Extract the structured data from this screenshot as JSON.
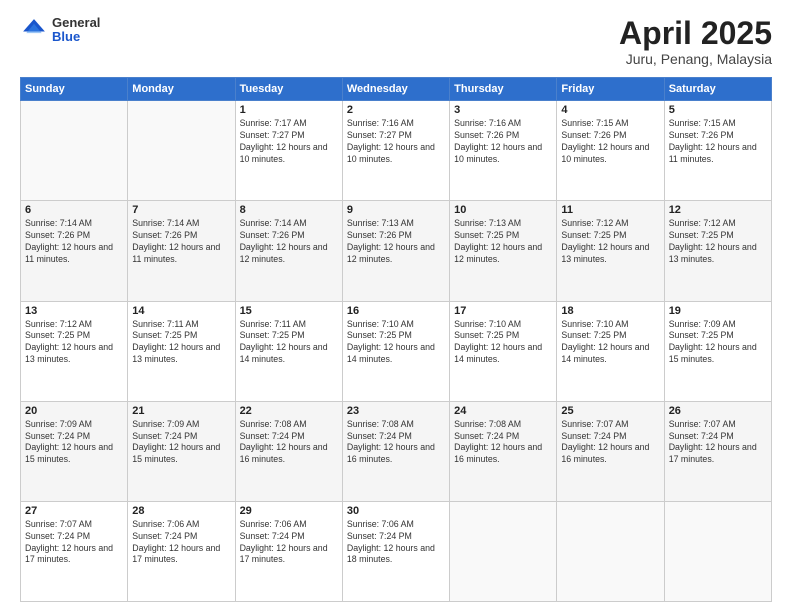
{
  "header": {
    "logo_general": "General",
    "logo_blue": "Blue",
    "title": "April 2025",
    "subtitle": "Juru, Penang, Malaysia"
  },
  "calendar": {
    "days_of_week": [
      "Sunday",
      "Monday",
      "Tuesday",
      "Wednesday",
      "Thursday",
      "Friday",
      "Saturday"
    ],
    "weeks": [
      [
        {
          "day": "",
          "info": ""
        },
        {
          "day": "",
          "info": ""
        },
        {
          "day": "1",
          "info": "Sunrise: 7:17 AM\nSunset: 7:27 PM\nDaylight: 12 hours and 10 minutes."
        },
        {
          "day": "2",
          "info": "Sunrise: 7:16 AM\nSunset: 7:27 PM\nDaylight: 12 hours and 10 minutes."
        },
        {
          "day": "3",
          "info": "Sunrise: 7:16 AM\nSunset: 7:26 PM\nDaylight: 12 hours and 10 minutes."
        },
        {
          "day": "4",
          "info": "Sunrise: 7:15 AM\nSunset: 7:26 PM\nDaylight: 12 hours and 10 minutes."
        },
        {
          "day": "5",
          "info": "Sunrise: 7:15 AM\nSunset: 7:26 PM\nDaylight: 12 hours and 11 minutes."
        }
      ],
      [
        {
          "day": "6",
          "info": "Sunrise: 7:14 AM\nSunset: 7:26 PM\nDaylight: 12 hours and 11 minutes."
        },
        {
          "day": "7",
          "info": "Sunrise: 7:14 AM\nSunset: 7:26 PM\nDaylight: 12 hours and 11 minutes."
        },
        {
          "day": "8",
          "info": "Sunrise: 7:14 AM\nSunset: 7:26 PM\nDaylight: 12 hours and 12 minutes."
        },
        {
          "day": "9",
          "info": "Sunrise: 7:13 AM\nSunset: 7:26 PM\nDaylight: 12 hours and 12 minutes."
        },
        {
          "day": "10",
          "info": "Sunrise: 7:13 AM\nSunset: 7:25 PM\nDaylight: 12 hours and 12 minutes."
        },
        {
          "day": "11",
          "info": "Sunrise: 7:12 AM\nSunset: 7:25 PM\nDaylight: 12 hours and 13 minutes."
        },
        {
          "day": "12",
          "info": "Sunrise: 7:12 AM\nSunset: 7:25 PM\nDaylight: 12 hours and 13 minutes."
        }
      ],
      [
        {
          "day": "13",
          "info": "Sunrise: 7:12 AM\nSunset: 7:25 PM\nDaylight: 12 hours and 13 minutes."
        },
        {
          "day": "14",
          "info": "Sunrise: 7:11 AM\nSunset: 7:25 PM\nDaylight: 12 hours and 13 minutes."
        },
        {
          "day": "15",
          "info": "Sunrise: 7:11 AM\nSunset: 7:25 PM\nDaylight: 12 hours and 14 minutes."
        },
        {
          "day": "16",
          "info": "Sunrise: 7:10 AM\nSunset: 7:25 PM\nDaylight: 12 hours and 14 minutes."
        },
        {
          "day": "17",
          "info": "Sunrise: 7:10 AM\nSunset: 7:25 PM\nDaylight: 12 hours and 14 minutes."
        },
        {
          "day": "18",
          "info": "Sunrise: 7:10 AM\nSunset: 7:25 PM\nDaylight: 12 hours and 14 minutes."
        },
        {
          "day": "19",
          "info": "Sunrise: 7:09 AM\nSunset: 7:25 PM\nDaylight: 12 hours and 15 minutes."
        }
      ],
      [
        {
          "day": "20",
          "info": "Sunrise: 7:09 AM\nSunset: 7:24 PM\nDaylight: 12 hours and 15 minutes."
        },
        {
          "day": "21",
          "info": "Sunrise: 7:09 AM\nSunset: 7:24 PM\nDaylight: 12 hours and 15 minutes."
        },
        {
          "day": "22",
          "info": "Sunrise: 7:08 AM\nSunset: 7:24 PM\nDaylight: 12 hours and 16 minutes."
        },
        {
          "day": "23",
          "info": "Sunrise: 7:08 AM\nSunset: 7:24 PM\nDaylight: 12 hours and 16 minutes."
        },
        {
          "day": "24",
          "info": "Sunrise: 7:08 AM\nSunset: 7:24 PM\nDaylight: 12 hours and 16 minutes."
        },
        {
          "day": "25",
          "info": "Sunrise: 7:07 AM\nSunset: 7:24 PM\nDaylight: 12 hours and 16 minutes."
        },
        {
          "day": "26",
          "info": "Sunrise: 7:07 AM\nSunset: 7:24 PM\nDaylight: 12 hours and 17 minutes."
        }
      ],
      [
        {
          "day": "27",
          "info": "Sunrise: 7:07 AM\nSunset: 7:24 PM\nDaylight: 12 hours and 17 minutes."
        },
        {
          "day": "28",
          "info": "Sunrise: 7:06 AM\nSunset: 7:24 PM\nDaylight: 12 hours and 17 minutes."
        },
        {
          "day": "29",
          "info": "Sunrise: 7:06 AM\nSunset: 7:24 PM\nDaylight: 12 hours and 17 minutes."
        },
        {
          "day": "30",
          "info": "Sunrise: 7:06 AM\nSunset: 7:24 PM\nDaylight: 12 hours and 18 minutes."
        },
        {
          "day": "",
          "info": ""
        },
        {
          "day": "",
          "info": ""
        },
        {
          "day": "",
          "info": ""
        }
      ]
    ]
  }
}
